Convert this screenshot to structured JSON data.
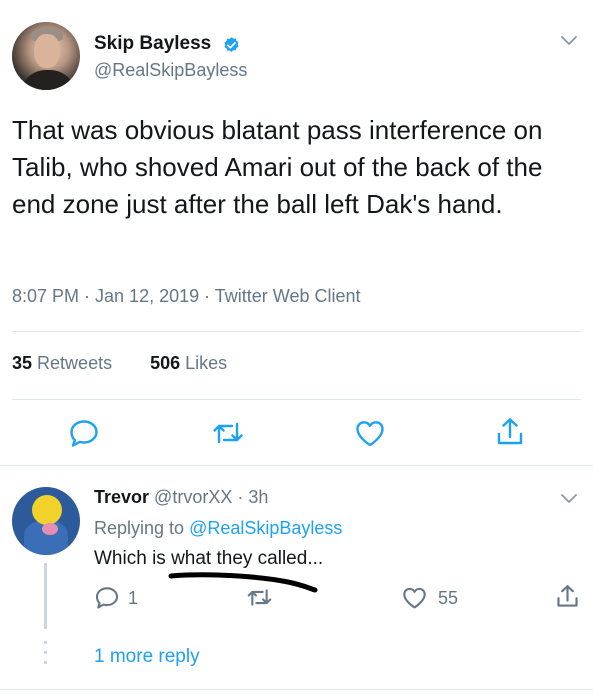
{
  "tweet": {
    "author_name": "Skip Bayless",
    "author_handle": "@RealSkipBayless",
    "text": "That was obvious blatant pass interference on Talib, who shoved Amari out of the back of the end zone just after the ball left Dak's hand.",
    "meta": "8:07 PM · Jan 12, 2019 · Twitter Web Client",
    "retweets_count": "35",
    "retweets_label": "Retweets",
    "likes_count": "506",
    "likes_label": "Likes"
  },
  "reply": {
    "author_name": "Trevor",
    "author_handle": "@trvorXX",
    "time": " · 3h",
    "replying_prefix": "Replying to ",
    "replying_to": "@RealSkipBayless",
    "text": "Which is what they called...",
    "reply_count": "1",
    "like_count": "55",
    "more_replies": "1 more reply"
  },
  "colors": {
    "text": "#14171a",
    "secondary": "#657786",
    "accent": "#1da1f2",
    "divider": "#e1e8ed"
  },
  "icons": [
    "verified-badge-icon",
    "chevron-down-icon",
    "reply-icon",
    "retweet-icon",
    "like-icon",
    "share-icon"
  ]
}
